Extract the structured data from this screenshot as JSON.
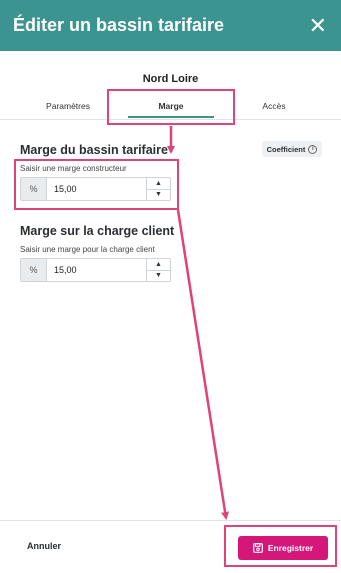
{
  "header": {
    "title": "Éditer un bassin tarifaire",
    "close_glyph": "✕"
  },
  "subtitle": "Nord Loire",
  "tabs": [
    {
      "label": "Paramètres"
    },
    {
      "label": "Marge",
      "active": true
    },
    {
      "label": "Accès"
    }
  ],
  "section1": {
    "title": "Marge du bassin tarifaire",
    "badge": "Coefficient",
    "field_label": "Saisir une marge constructeur",
    "prefix": "%",
    "value": "15,00"
  },
  "section2": {
    "title": "Marge sur la charge client",
    "field_label": "Saisir une marge pour la charge client",
    "prefix": "%",
    "value": "15,00"
  },
  "footer": {
    "cancel_label": "Annuler",
    "save_label": "Enregistrer"
  },
  "colors": {
    "header": "#3b9490",
    "primary": "#d6177a",
    "annotation": "#e0427c"
  }
}
